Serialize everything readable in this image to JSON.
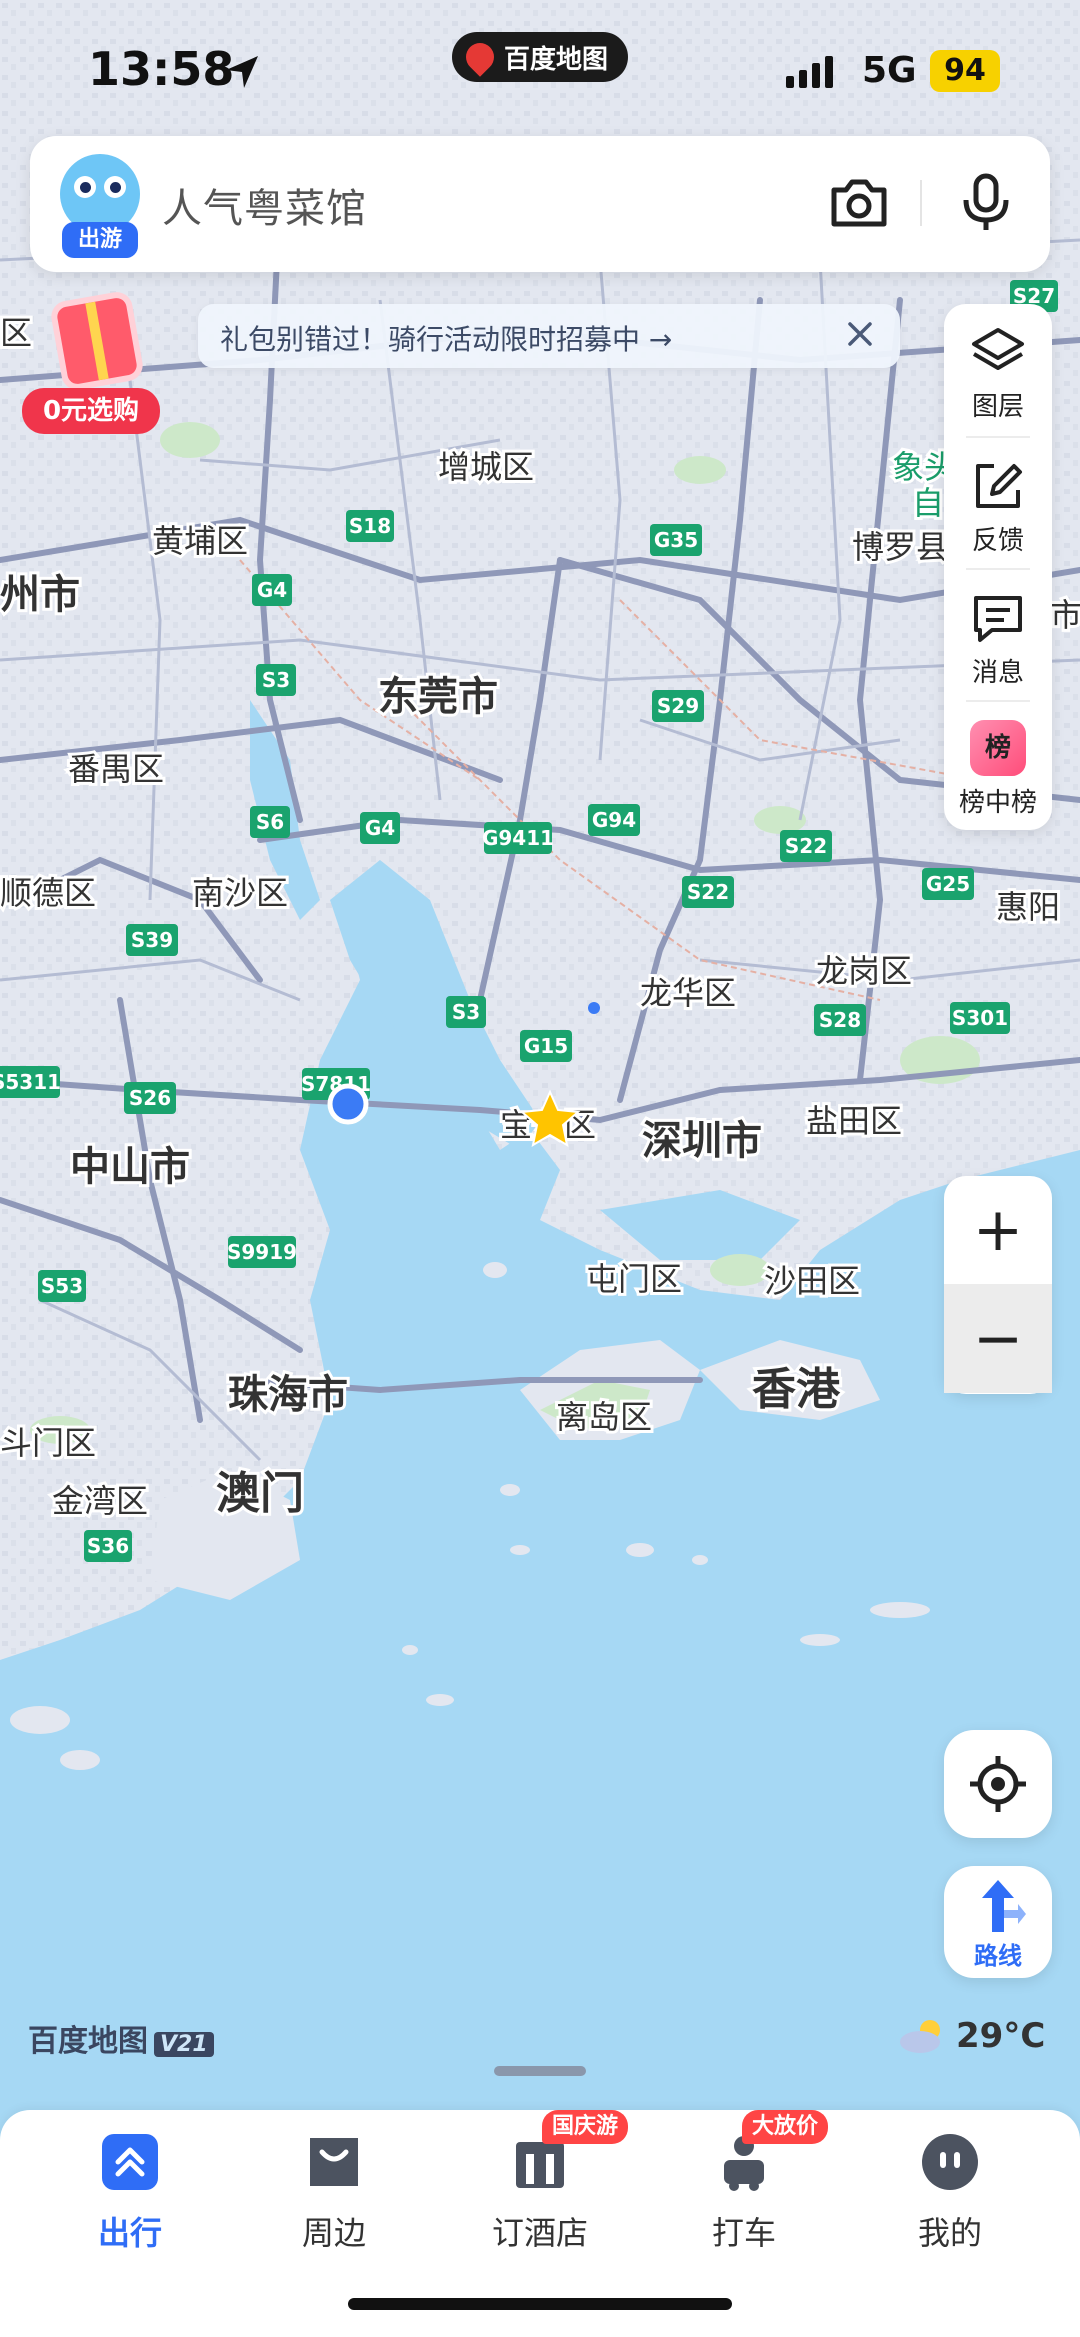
{
  "status_bar": {
    "time": "13:58",
    "app_name": "百度地图",
    "network": "5G",
    "battery": "94"
  },
  "search": {
    "placeholder": "人气粤菜馆",
    "mascot_tag": "出游"
  },
  "promo": {
    "tag": "0元选购"
  },
  "banner": {
    "text": "礼包别错过！骑行活动限时招募中 →"
  },
  "toolbar": {
    "layers": "图层",
    "feedback": "反馈",
    "messages": "消息",
    "ranking": "榜中榜",
    "ranking_glyph": "榜"
  },
  "map": {
    "places": [
      {
        "id": "zengcheng",
        "label": "增城区"
      },
      {
        "id": "huangpu",
        "label": "黄埔区"
      },
      {
        "id": "zhou",
        "label": "州市"
      },
      {
        "id": "dongguan",
        "label": "东莞市"
      },
      {
        "id": "boluo",
        "label": "博罗县"
      },
      {
        "id": "panyu",
        "label": "番禺区"
      },
      {
        "id": "shunde",
        "label": "顺德区"
      },
      {
        "id": "nansha",
        "label": "南沙区"
      },
      {
        "id": "longhua",
        "label": "龙华区"
      },
      {
        "id": "longgang",
        "label": "龙岗区"
      },
      {
        "id": "huiyang",
        "label": "惠阳"
      },
      {
        "id": "zhongshan",
        "label": "中山市"
      },
      {
        "id": "baoan",
        "label": "宝安区"
      },
      {
        "id": "shenzhen",
        "label": "深圳市"
      },
      {
        "id": "yantian",
        "label": "盐田区"
      },
      {
        "id": "tuenmun",
        "label": "屯门区"
      },
      {
        "id": "shatin",
        "label": "沙田区"
      },
      {
        "id": "zhuhai",
        "label": "珠海市"
      },
      {
        "id": "hongkong",
        "label": "香港"
      },
      {
        "id": "islands",
        "label": "离岛区"
      },
      {
        "id": "doumen",
        "label": "斗门区"
      },
      {
        "id": "macau",
        "label": "澳门"
      },
      {
        "id": "jinwan",
        "label": "金湾区"
      },
      {
        "id": "xiangtou",
        "label": "象头"
      },
      {
        "id": "zi",
        "label": "自"
      },
      {
        "id": "shi_right",
        "label": "市"
      },
      {
        "id": "qu_left",
        "label": "区"
      }
    ],
    "shields": [
      {
        "id": "s18a",
        "label": "S18"
      },
      {
        "id": "g4a",
        "label": "G4"
      },
      {
        "id": "s3a",
        "label": "S3"
      },
      {
        "id": "g35",
        "label": "G35"
      },
      {
        "id": "s29",
        "label": "S29"
      },
      {
        "id": "s6",
        "label": "S6"
      },
      {
        "id": "g4b",
        "label": "G4"
      },
      {
        "id": "g9411",
        "label": "G9411"
      },
      {
        "id": "g94",
        "label": "G94"
      },
      {
        "id": "s22a",
        "label": "S22"
      },
      {
        "id": "s22b",
        "label": "S22"
      },
      {
        "id": "g25",
        "label": "G25"
      },
      {
        "id": "s39",
        "label": "S39"
      },
      {
        "id": "s3b",
        "label": "S3"
      },
      {
        "id": "g15",
        "label": "G15"
      },
      {
        "id": "s28",
        "label": "S28"
      },
      {
        "id": "s301",
        "label": "S301"
      },
      {
        "id": "s5311",
        "label": "S5311"
      },
      {
        "id": "s26",
        "label": "S26"
      },
      {
        "id": "s7811",
        "label": "S7811"
      },
      {
        "id": "s9919",
        "label": "S9919"
      },
      {
        "id": "s53",
        "label": "S53"
      },
      {
        "id": "s36",
        "label": "S36"
      },
      {
        "id": "s27",
        "label": "S27"
      }
    ],
    "colors": {
      "land": "#e6e9f1",
      "water": "#a6d8f4",
      "road": "#8f98b8",
      "green": "#cde8c9",
      "shield": "#1aa36e"
    }
  },
  "logo": {
    "text": "百度地图",
    "version": "V21"
  },
  "weather": {
    "temperature": "29°C"
  },
  "bottom_nav": [
    {
      "label": "出行",
      "active": true
    },
    {
      "label": "周边"
    },
    {
      "label": "订酒店",
      "badge": "国庆游"
    },
    {
      "label": "打车",
      "badge": "大放价"
    },
    {
      "label": "我的"
    }
  ]
}
